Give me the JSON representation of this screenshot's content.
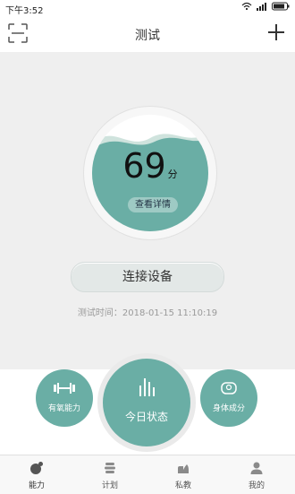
{
  "status_bar": {
    "time": "下午3:52"
  },
  "header": {
    "title": "测试"
  },
  "score": {
    "value": "69",
    "unit": "分",
    "detail_label": "查看详情"
  },
  "connect": {
    "label": "连接设备"
  },
  "test_time": {
    "text": "测试时间：2018-01-15 11:10:19"
  },
  "actions": {
    "left_label": "有氧能力",
    "center_label": "今日状态",
    "right_label": "身体成分"
  },
  "tabs": [
    {
      "label": "能力",
      "icon": "ability-icon"
    },
    {
      "label": "计划",
      "icon": "plan-icon"
    },
    {
      "label": "私教",
      "icon": "coach-icon"
    },
    {
      "label": "我的",
      "icon": "profile-icon"
    }
  ],
  "colors": {
    "accent": "#6aaea5",
    "header_bg": "#ffffff",
    "page_bg": "#efefef"
  }
}
